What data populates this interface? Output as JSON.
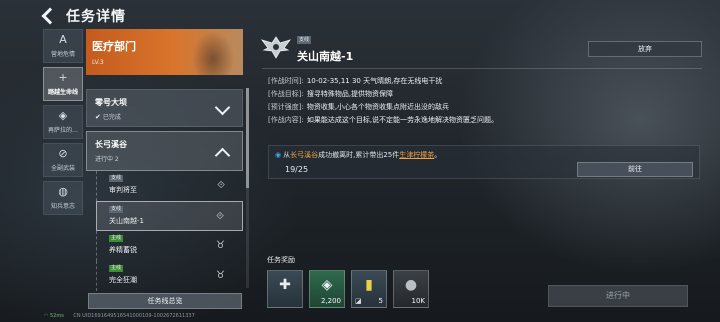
{
  "header": {
    "title": "任务详情"
  },
  "nav": [
    {
      "icon": "A",
      "label": "营地危情",
      "active": false
    },
    {
      "icon": "+",
      "label": "踏越生命线",
      "active": true
    },
    {
      "icon": "◈",
      "label": "再萨拉的…",
      "active": false
    },
    {
      "icon": "⊘",
      "label": "全副武装",
      "active": false
    },
    {
      "icon": "◍",
      "label": "知兵意志",
      "active": false
    }
  ],
  "list": {
    "department": {
      "name": "医疗部门",
      "level": "LV.3"
    },
    "chapters": [
      {
        "name": "零号大坝",
        "status": "已完成"
      },
      {
        "name": "长弓溪谷",
        "status": "进行中 2"
      }
    ],
    "subtasks": [
      {
        "tag": "支线",
        "name": "审判将至"
      },
      {
        "tag": "支线",
        "name": "关山南越-1"
      },
      {
        "tag": "主线",
        "name": "养精蓄锐"
      },
      {
        "tag": "主线",
        "name": "完全狂潮"
      }
    ],
    "overview_label": "任务线总览"
  },
  "detail": {
    "tag": "支线",
    "title": "关山南越-1",
    "abandon_label": "放弃",
    "info": [
      {
        "key": "[作战时间]:",
        "value": "10-02-35,11  30 天气晴朗,存在无线电干扰"
      },
      {
        "key": "[作战目标]:",
        "value": "搜寻特殊物品,提供物资保障"
      },
      {
        "key": "[预计强度]:",
        "value": "物资收集,小心各个物资收集点附近出没的敌兵"
      },
      {
        "key": "[作战内容]:",
        "value": "如果能达成这个目标,说不定能一劳永逸地解决物资匮乏问题。"
      }
    ],
    "objective": {
      "prefix": "从",
      "place": "长弓溪谷",
      "middle": "成功撤离时,累计带出25件",
      "item": "生津柠檬茶",
      "suffix": "。",
      "progress": "19/25",
      "goto_label": "前往"
    },
    "reward_title": "任务奖励",
    "rewards": [
      {
        "icon": "shield-plus",
        "glyph": "✚",
        "qty": "",
        "sub": "",
        "style": ""
      },
      {
        "icon": "currency",
        "glyph": "◈",
        "qty": "2,200",
        "sub": "",
        "style": "green"
      },
      {
        "icon": "battery",
        "glyph": "▮",
        "qty": "5",
        "sub": "◪",
        "style": ""
      },
      {
        "icon": "coin",
        "glyph": "●",
        "qty": "10K",
        "sub": "",
        "style": "dark"
      }
    ],
    "status_button": "进行中"
  },
  "footer": {
    "ping": "52ms",
    "uid": "CN UID1691649516541000109-1002672611337"
  },
  "colors": {
    "accent_orange": "#d9742b",
    "highlight": "#f0a441",
    "objective_dot": "#3ea8e0",
    "main_tag": "#3e8b3a"
  }
}
